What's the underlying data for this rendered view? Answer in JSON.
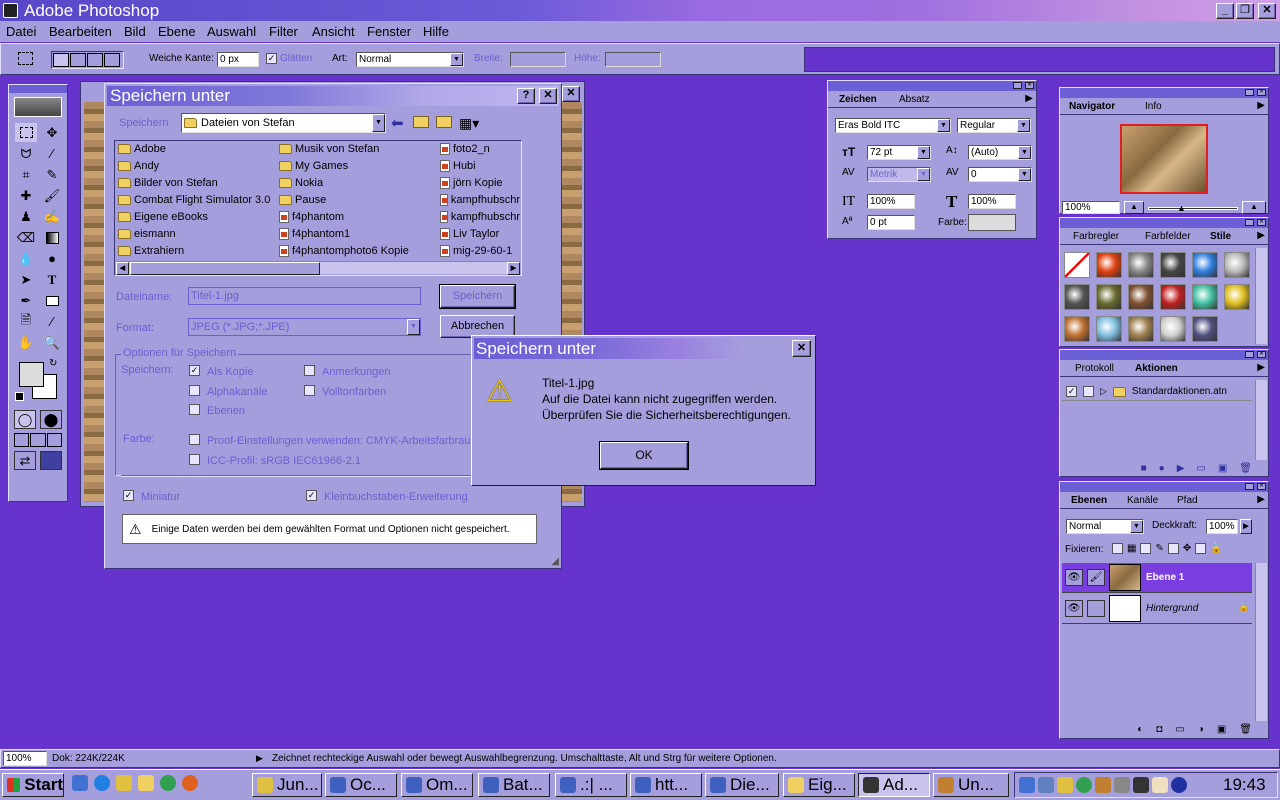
{
  "app": {
    "title": "Adobe Photoshop"
  },
  "menu": [
    "Datei",
    "Bearbeiten",
    "Bild",
    "Ebene",
    "Auswahl",
    "Filter",
    "Ansicht",
    "Fenster",
    "Hilfe"
  ],
  "options_bar": {
    "feather_label": "Weiche Kante:",
    "feather_value": "0 px",
    "antialias_label": "Glätten",
    "style_label": "Art:",
    "style_value": "Normal",
    "width_label": "Breite:",
    "height_label": "Höhe:"
  },
  "save_dialog": {
    "title": "Speichern unter",
    "save_in_label": "Speichern",
    "folder": "Dateien von Stefan",
    "col1": [
      "Adobe",
      "Andy",
      "Bilder von Stefan",
      "Combat Flight Simulator 3.0",
      "Eigene eBooks",
      "eismann",
      "Extrahiern"
    ],
    "col2": [
      "Musik von Stefan",
      "My Games",
      "Nokia",
      "Pause",
      "f4phantom",
      "f4phantom1",
      "f4phantomphoto6 Kopie"
    ],
    "col3": [
      "foto2_n",
      "Hubi",
      "jörn Kopie",
      "kampfhubschr",
      "kampfhubschr",
      "Liv Taylor",
      "mig-29-60-1"
    ],
    "filename_label": "Dateiname:",
    "filename_value": "Titel-1.jpg",
    "format_label": "Format:",
    "format_value": "JPEG (*.JPG;*.JPE)",
    "save_button": "Speichern",
    "cancel_button": "Abbrechen",
    "options_group": "Optionen für Speichern",
    "save_label": "Speichern:",
    "opt_as_copy": "Als Kopie",
    "opt_annotations": "Anmerkungen",
    "opt_alpha": "Alphakanäle",
    "opt_spot": "Volltonfarben",
    "opt_layers": "Ebenen",
    "color_label": "Farbe:",
    "opt_proof": "Proof-Einstellungen verwenden: CMYK-Arbeitsfarbraum",
    "opt_icc": "ICC-Profil: sRGB IEC61966-2.1",
    "opt_thumbnail": "Miniatur",
    "opt_lowercase": "Kleinbuchstaben-Erweiterung",
    "warning": "Einige Daten werden bei dem gewählten Format und Optionen nicht gespeichert."
  },
  "alert": {
    "title": "Speichern unter",
    "line1": "Titel-1.jpg",
    "line2": "Auf die Datei kann nicht zugegriffen werden.",
    "line3": "Überprüfen Sie die Sicherheitsberechtigungen.",
    "ok": "OK"
  },
  "char_panel": {
    "tabs": [
      "Zeichen",
      "Absatz"
    ],
    "font": "Eras Bold ITC",
    "style": "Regular",
    "size": "72 pt",
    "leading": "(Auto)",
    "kerning": "Metrik",
    "tracking": "0",
    "vscale": "100%",
    "hscale": "100%",
    "baseline": "0 pt",
    "color_label": "Farbe:"
  },
  "navigator": {
    "tabs": [
      "Navigator",
      "Info"
    ],
    "zoom": "100%"
  },
  "styles_panel": {
    "tabs": [
      "Farbregler",
      "Farbfelder",
      "Stile"
    ]
  },
  "actions_panel": {
    "tabs": [
      "Protokoll",
      "Aktionen"
    ],
    "item": "Standardaktionen.atn"
  },
  "layers_panel": {
    "tabs": [
      "Ebenen",
      "Kanäle",
      "Pfad"
    ],
    "blend": "Normal",
    "opacity_label": "Deckkraft:",
    "opacity": "100%",
    "lock_label": "Fixieren:",
    "layers": [
      "Ebene 1",
      "Hintergrund"
    ]
  },
  "status": {
    "zoom": "100%",
    "doc": "Dok: 224K/224K",
    "hint": "Zeichnet rechteckige Auswahl oder bewegt Auswahlbegrenzung.  Umschalttaste, Alt und Strg für weitere Optionen."
  },
  "taskbar": {
    "start": "Start",
    "items": [
      "Jun...",
      "Oc...",
      "Om...",
      "Bat...",
      ".:| ...",
      "htt...",
      "Die...",
      "Eig...",
      "Ad...",
      "Un..."
    ],
    "clock": "19:43"
  },
  "colors": {
    "desktop": "#6633cc",
    "face": "#a59edc",
    "titlebar": "#6b5fd6",
    "active_layer": "#7a3ee0"
  }
}
